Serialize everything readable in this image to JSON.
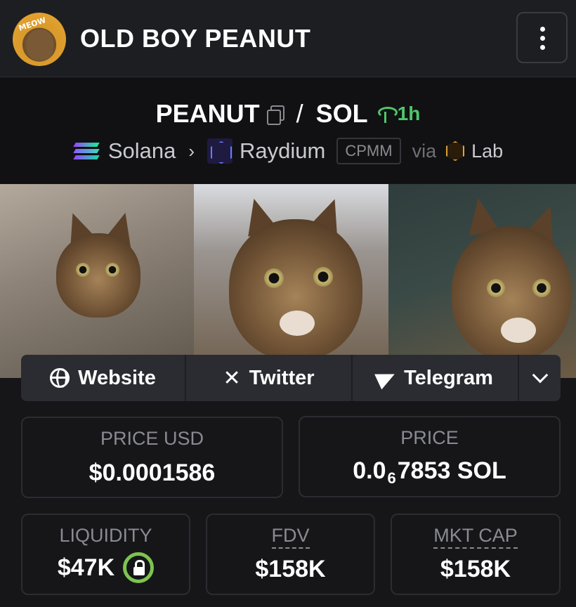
{
  "header": {
    "token_name": "OLD BOY PEANUT",
    "avatar_text": "MEOW",
    "menu_icon": "more-vertical-icon"
  },
  "pair": {
    "base": "PEANUT",
    "quote": "SOL",
    "separator": "/",
    "age": "1h",
    "chain": "Solana",
    "dex": "Raydium",
    "pool_type": "CPMM",
    "via_label": "via",
    "via_source": "Lab",
    "age_color": "#4ec66a"
  },
  "links": {
    "website": "Website",
    "twitter": "Twitter",
    "telegram": "Telegram"
  },
  "stats": {
    "price_usd_label": "PRICE USD",
    "price_usd_value": "$0.0001586",
    "price_label": "PRICE",
    "price_prefix": "0.0",
    "price_subscript": "6",
    "price_suffix": "7853 SOL",
    "liquidity_label": "LIQUIDITY",
    "liquidity_value": "$47K",
    "fdv_label": "FDV",
    "fdv_value": "$158K",
    "mkt_cap_label": "MKT CAP",
    "mkt_cap_value": "$158K",
    "lock_color": "#7cc44f"
  }
}
